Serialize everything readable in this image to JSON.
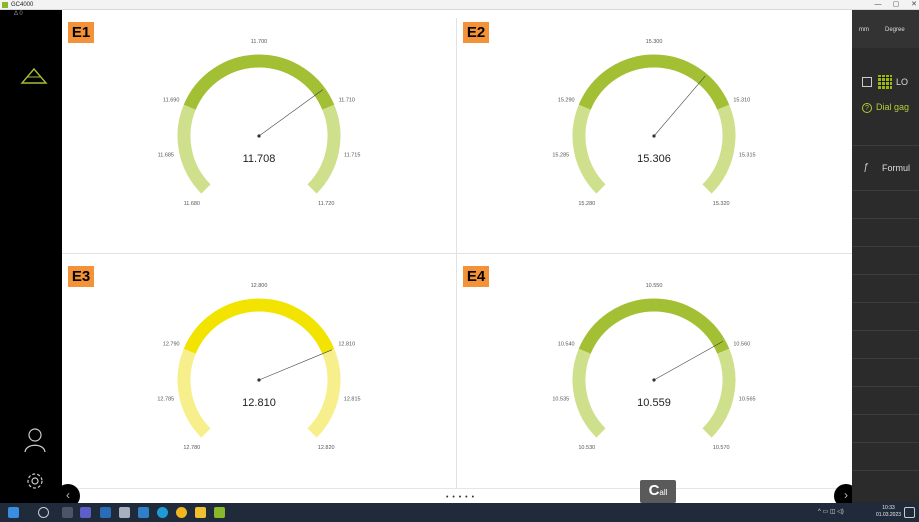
{
  "window": {
    "title": "GC4000",
    "minimize": "—",
    "maximize": "▢",
    "close": "✕"
  },
  "sidebar": {
    "indicator": "Δ 0"
  },
  "gauges": [
    {
      "id": "E1",
      "value": "11.708",
      "value_num": 11.708,
      "min": 11.68,
      "max": 11.72,
      "ticks": [
        "11.680",
        "11.685",
        "11.690",
        "11.700",
        "11.710",
        "11.715",
        "11.720"
      ],
      "color_light": "#cfe08d",
      "color_dark": "#a3bf33"
    },
    {
      "id": "E2",
      "value": "15.306",
      "value_num": 15.306,
      "min": 15.28,
      "max": 15.32,
      "ticks": [
        "15.280",
        "15.285",
        "15.290",
        "15.300",
        "15.310",
        "15.315",
        "15.320"
      ],
      "color_light": "#cfe08d",
      "color_dark": "#a3bf33"
    },
    {
      "id": "E3",
      "value": "12.810",
      "value_num": 12.81,
      "min": 12.78,
      "max": 12.82,
      "ticks": [
        "12.780",
        "12.785",
        "12.790",
        "12.800",
        "12.810",
        "12.815",
        "12.820"
      ],
      "color_light": "#f7ef8b",
      "color_dark": "#f2e400"
    },
    {
      "id": "E4",
      "value": "10.559",
      "value_num": 10.559,
      "min": 10.53,
      "max": 10.57,
      "ticks": [
        "10.530",
        "10.535",
        "10.540",
        "10.550",
        "10.560",
        "10.565",
        "10.570"
      ],
      "color_light": "#cfe08d",
      "color_dark": "#a3bf33"
    }
  ],
  "pager": {
    "dots": "• • • • •"
  },
  "call_button": {
    "big": "C",
    "small": "all"
  },
  "right_panel": {
    "units": [
      "mm",
      "Degree"
    ],
    "log_label": "LO",
    "dial_label": "Dial gag",
    "formula_label": "Formul"
  },
  "taskbar": {
    "time": "10:33",
    "date": "01.03.2023"
  }
}
